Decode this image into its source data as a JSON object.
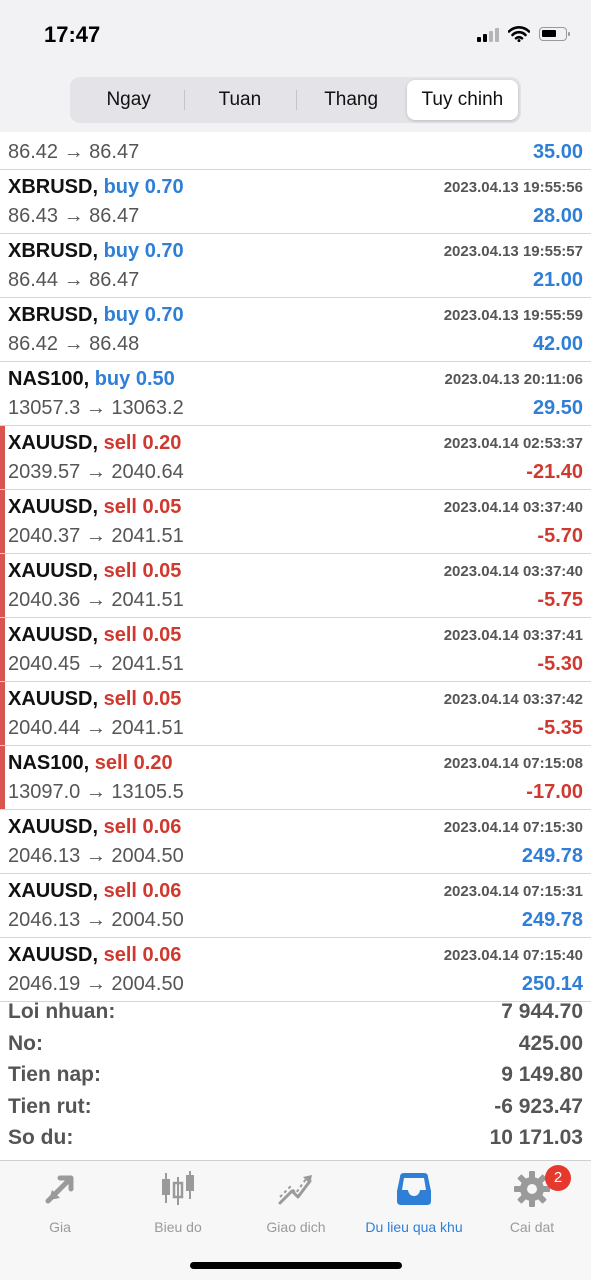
{
  "status": {
    "time": "17:47"
  },
  "segments": [
    "Ngay",
    "Tuan",
    "Thang",
    "Tuy chinh"
  ],
  "active_segment": 3,
  "partial_row": {
    "prices": "86.42 → 86.47",
    "profit": "35.00"
  },
  "trades": [
    {
      "symbol": "XBRUSD,",
      "side": "buy 0.70",
      "time": "2023.04.13 19:55:56",
      "prices": "86.43 → 86.47",
      "profit": "28.00"
    },
    {
      "symbol": "XBRUSD,",
      "side": "buy 0.70",
      "time": "2023.04.13 19:55:57",
      "prices": "86.44 → 86.47",
      "profit": "21.00"
    },
    {
      "symbol": "XBRUSD,",
      "side": "buy 0.70",
      "time": "2023.04.13 19:55:59",
      "prices": "86.42 → 86.48",
      "profit": "42.00"
    },
    {
      "symbol": "NAS100,",
      "side": "buy 0.50",
      "time": "2023.04.13 20:11:06",
      "prices": "13057.3 → 13063.2",
      "profit": "29.50"
    },
    {
      "symbol": "XAUUSD,",
      "side": "sell 0.20",
      "time": "2023.04.14 02:53:37",
      "prices": "2039.57 → 2040.64",
      "profit": "-21.40"
    },
    {
      "symbol": "XAUUSD,",
      "side": "sell 0.05",
      "time": "2023.04.14 03:37:40",
      "prices": "2040.37 → 2041.51",
      "profit": "-5.70"
    },
    {
      "symbol": "XAUUSD,",
      "side": "sell 0.05",
      "time": "2023.04.14 03:37:40",
      "prices": "2040.36 → 2041.51",
      "profit": "-5.75"
    },
    {
      "symbol": "XAUUSD,",
      "side": "sell 0.05",
      "time": "2023.04.14 03:37:41",
      "prices": "2040.45 → 2041.51",
      "profit": "-5.30"
    },
    {
      "symbol": "XAUUSD,",
      "side": "sell 0.05",
      "time": "2023.04.14 03:37:42",
      "prices": "2040.44 → 2041.51",
      "profit": "-5.35"
    },
    {
      "symbol": "NAS100,",
      "side": "sell 0.20",
      "time": "2023.04.14 07:15:08",
      "prices": "13097.0 → 13105.5",
      "profit": "-17.00"
    },
    {
      "symbol": "XAUUSD,",
      "side": "sell 0.06",
      "time": "2023.04.14 07:15:30",
      "prices": "2046.13 → 2004.50",
      "profit": "249.78"
    },
    {
      "symbol": "XAUUSD,",
      "side": "sell 0.06",
      "time": "2023.04.14 07:15:31",
      "prices": "2046.13 → 2004.50",
      "profit": "249.78"
    },
    {
      "symbol": "XAUUSD,",
      "side": "sell 0.06",
      "time": "2023.04.14 07:15:40",
      "prices": "2046.19 → 2004.50",
      "profit": "250.14"
    }
  ],
  "summary": [
    {
      "label": "Loi nhuan:",
      "value": "7 944.70"
    },
    {
      "label": "No:",
      "value": "425.00"
    },
    {
      "label": "Tien nap:",
      "value": "9 149.80"
    },
    {
      "label": "Tien rut:",
      "value": "-6 923.47"
    },
    {
      "label": "So du:",
      "value": "10 171.03"
    }
  ],
  "tabs": [
    {
      "label": "Gia",
      "icon": "quotes-arrows-icon"
    },
    {
      "label": "Bieu do",
      "icon": "candlestick-chart-icon"
    },
    {
      "label": "Giao dich",
      "icon": "trade-chart-icon"
    },
    {
      "label": "Du lieu qua khu",
      "icon": "history-inbox-icon"
    },
    {
      "label": "Cai dat",
      "icon": "gear-icon",
      "badge": "2"
    }
  ],
  "active_tab": 3,
  "colors": {
    "buy": "#2f7fd6",
    "sell": "#d0392f",
    "loss_flag": "#d9534f",
    "badge": "#e5392e"
  }
}
